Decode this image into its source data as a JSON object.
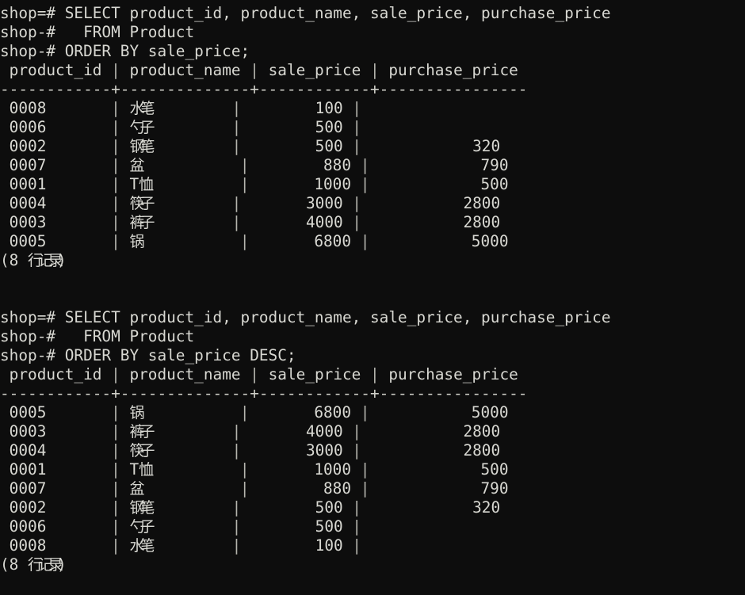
{
  "terminal": {
    "colors": {
      "background": "#0d0d0d",
      "foreground": "#d8d8d2",
      "separator": "#cfcfc8"
    },
    "column_widths": {
      "product_id": 12,
      "product_name": 14,
      "sale_price": 12,
      "purchase_price": 16
    },
    "blocks": [
      {
        "prompt_lines": [
          "shop=# SELECT product_id, product_name, sale_price, purchase_price",
          "shop-#   FROM Product",
          "shop-# ORDER BY sale_price;"
        ],
        "headers": [
          "product_id",
          "product_name",
          "sale_price",
          "purchase_price"
        ],
        "separator": "------------+--------------+------------+----------------",
        "rows": [
          {
            "product_id": "0008",
            "product_name": "水笔",
            "sale_price": "100",
            "purchase_price": ""
          },
          {
            "product_id": "0006",
            "product_name": "勺子",
            "sale_price": "500",
            "purchase_price": ""
          },
          {
            "product_id": "0002",
            "product_name": "钢笔",
            "sale_price": "500",
            "purchase_price": "320"
          },
          {
            "product_id": "0007",
            "product_name": "盆",
            "sale_price": "880",
            "purchase_price": "790"
          },
          {
            "product_id": "0001",
            "product_name": "T恤",
            "sale_price": "1000",
            "purchase_price": "500"
          },
          {
            "product_id": "0004",
            "product_name": "筷子",
            "sale_price": "3000",
            "purchase_price": "2800"
          },
          {
            "product_id": "0003",
            "product_name": "裤子",
            "sale_price": "4000",
            "purchase_price": "2800"
          },
          {
            "product_id": "0005",
            "product_name": "锅",
            "sale_price": "6800",
            "purchase_price": "5000"
          }
        ],
        "row_count_label": "(8 行记录)"
      },
      {
        "prompt_lines": [
          "shop=# SELECT product_id, product_name, sale_price, purchase_price",
          "shop-#   FROM Product",
          "shop-# ORDER BY sale_price DESC;"
        ],
        "headers": [
          "product_id",
          "product_name",
          "sale_price",
          "purchase_price"
        ],
        "separator": "------------+--------------+------------+----------------",
        "rows": [
          {
            "product_id": "0005",
            "product_name": "锅",
            "sale_price": "6800",
            "purchase_price": "5000"
          },
          {
            "product_id": "0003",
            "product_name": "裤子",
            "sale_price": "4000",
            "purchase_price": "2800"
          },
          {
            "product_id": "0004",
            "product_name": "筷子",
            "sale_price": "3000",
            "purchase_price": "2800"
          },
          {
            "product_id": "0001",
            "product_name": "T恤",
            "sale_price": "1000",
            "purchase_price": "500"
          },
          {
            "product_id": "0007",
            "product_name": "盆",
            "sale_price": "880",
            "purchase_price": "790"
          },
          {
            "product_id": "0002",
            "product_name": "钢笔",
            "sale_price": "500",
            "purchase_price": "320"
          },
          {
            "product_id": "0006",
            "product_name": "勺子",
            "sale_price": "500",
            "purchase_price": ""
          },
          {
            "product_id": "0008",
            "product_name": "水笔",
            "sale_price": "100",
            "purchase_price": ""
          }
        ],
        "row_count_label": "(8 行记录)"
      }
    ]
  }
}
